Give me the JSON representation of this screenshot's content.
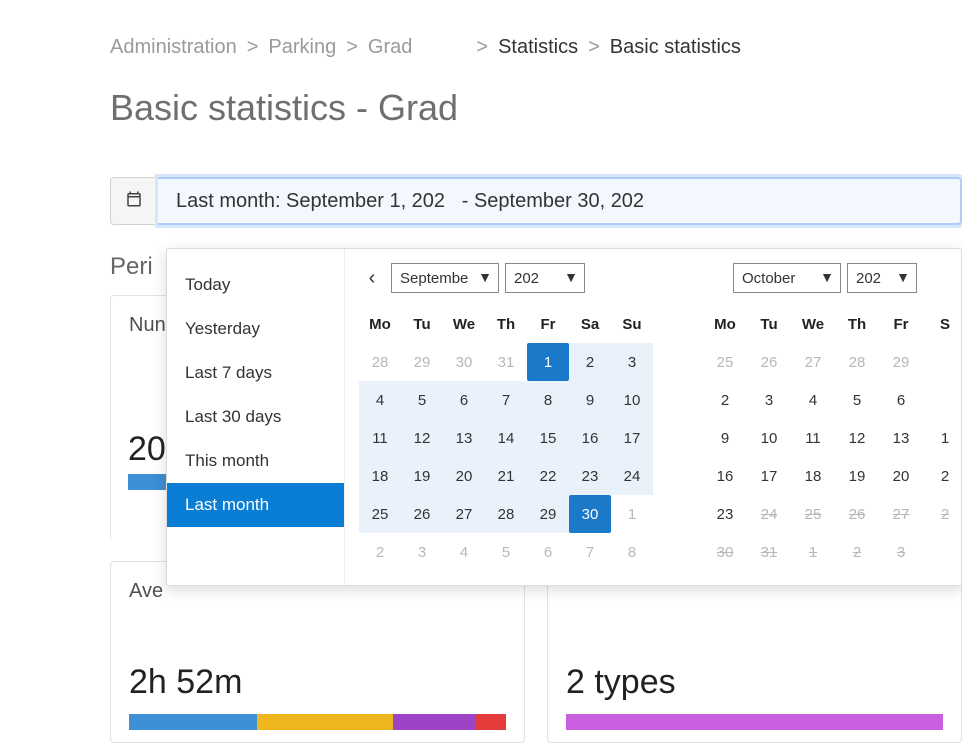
{
  "breadcrumb": {
    "items": [
      {
        "label": "Administration",
        "dark": false
      },
      {
        "label": "Parking",
        "dark": false
      },
      {
        "label": "Grad",
        "dark": false
      },
      {
        "label": "Statistics",
        "dark": true
      },
      {
        "label": "Basic statistics",
        "dark": true
      }
    ],
    "sep": ">"
  },
  "title": "Basic statistics - Grad",
  "date_range": {
    "value": "Last month: September 1, 202   - September 30, 202"
  },
  "section_label": "Peri",
  "cards": {
    "num": {
      "label": "Nun",
      "value": "20"
    },
    "avg": {
      "label": "Ave",
      "value": "2h 52m",
      "bar": [
        {
          "color": "#3e8fd4",
          "flex": 34
        },
        {
          "color": "#f0b61e",
          "flex": 36
        },
        {
          "color": "#9b44c6",
          "flex": 22
        },
        {
          "color": "#e43b3b",
          "flex": 8
        }
      ]
    },
    "types": {
      "value": "2 types",
      "bar": [
        {
          "color": "#c95fde",
          "flex": 100
        }
      ]
    }
  },
  "picker": {
    "presets": [
      "Today",
      "Yesterday",
      "Last 7 days",
      "Last 30 days",
      "This month",
      "Last month"
    ],
    "selected_preset": "Last month",
    "weekdays": [
      "Mo",
      "Tu",
      "We",
      "Th",
      "Fr",
      "Sa",
      "Su"
    ],
    "left": {
      "month": "Septembe",
      "year": "202",
      "cells": [
        {
          "d": "28",
          "cls": "muted"
        },
        {
          "d": "29",
          "cls": "muted"
        },
        {
          "d": "30",
          "cls": "muted"
        },
        {
          "d": "31",
          "cls": "muted"
        },
        {
          "d": "1",
          "cls": "start"
        },
        {
          "d": "2",
          "cls": "in-range"
        },
        {
          "d": "3",
          "cls": "in-range"
        },
        {
          "d": "4",
          "cls": "in-range"
        },
        {
          "d": "5",
          "cls": "in-range"
        },
        {
          "d": "6",
          "cls": "in-range"
        },
        {
          "d": "7",
          "cls": "in-range"
        },
        {
          "d": "8",
          "cls": "in-range"
        },
        {
          "d": "9",
          "cls": "in-range"
        },
        {
          "d": "10",
          "cls": "in-range"
        },
        {
          "d": "11",
          "cls": "in-range"
        },
        {
          "d": "12",
          "cls": "in-range"
        },
        {
          "d": "13",
          "cls": "in-range"
        },
        {
          "d": "14",
          "cls": "in-range"
        },
        {
          "d": "15",
          "cls": "in-range"
        },
        {
          "d": "16",
          "cls": "in-range"
        },
        {
          "d": "17",
          "cls": "in-range"
        },
        {
          "d": "18",
          "cls": "in-range"
        },
        {
          "d": "19",
          "cls": "in-range"
        },
        {
          "d": "20",
          "cls": "in-range"
        },
        {
          "d": "21",
          "cls": "in-range"
        },
        {
          "d": "22",
          "cls": "in-range"
        },
        {
          "d": "23",
          "cls": "in-range"
        },
        {
          "d": "24",
          "cls": "in-range"
        },
        {
          "d": "25",
          "cls": "in-range"
        },
        {
          "d": "26",
          "cls": "in-range"
        },
        {
          "d": "27",
          "cls": "in-range"
        },
        {
          "d": "28",
          "cls": "in-range"
        },
        {
          "d": "29",
          "cls": "in-range"
        },
        {
          "d": "30",
          "cls": "end"
        },
        {
          "d": "1",
          "cls": "muted"
        },
        {
          "d": "2",
          "cls": "muted"
        },
        {
          "d": "3",
          "cls": "muted"
        },
        {
          "d": "4",
          "cls": "muted"
        },
        {
          "d": "5",
          "cls": "muted"
        },
        {
          "d": "6",
          "cls": "muted"
        },
        {
          "d": "7",
          "cls": "muted"
        },
        {
          "d": "8",
          "cls": "muted"
        }
      ]
    },
    "right": {
      "month": "October",
      "year": "202",
      "weekdays": [
        "Mo",
        "Tu",
        "We",
        "Th",
        "Fr",
        "S"
      ],
      "cells": [
        {
          "d": "25",
          "cls": "muted"
        },
        {
          "d": "26",
          "cls": "muted"
        },
        {
          "d": "27",
          "cls": "muted"
        },
        {
          "d": "28",
          "cls": "muted"
        },
        {
          "d": "29",
          "cls": "muted"
        },
        {
          "d": "",
          "cls": ""
        },
        {
          "d": "2",
          "cls": ""
        },
        {
          "d": "3",
          "cls": ""
        },
        {
          "d": "4",
          "cls": ""
        },
        {
          "d": "5",
          "cls": ""
        },
        {
          "d": "6",
          "cls": ""
        },
        {
          "d": "",
          "cls": ""
        },
        {
          "d": "9",
          "cls": ""
        },
        {
          "d": "10",
          "cls": ""
        },
        {
          "d": "11",
          "cls": ""
        },
        {
          "d": "12",
          "cls": ""
        },
        {
          "d": "13",
          "cls": ""
        },
        {
          "d": "1",
          "cls": ""
        },
        {
          "d": "16",
          "cls": ""
        },
        {
          "d": "17",
          "cls": ""
        },
        {
          "d": "18",
          "cls": ""
        },
        {
          "d": "19",
          "cls": ""
        },
        {
          "d": "20",
          "cls": ""
        },
        {
          "d": "2",
          "cls": ""
        },
        {
          "d": "23",
          "cls": ""
        },
        {
          "d": "24",
          "cls": "disabled"
        },
        {
          "d": "25",
          "cls": "disabled"
        },
        {
          "d": "26",
          "cls": "disabled"
        },
        {
          "d": "27",
          "cls": "disabled"
        },
        {
          "d": "2",
          "cls": "disabled"
        },
        {
          "d": "30",
          "cls": "disabled"
        },
        {
          "d": "31",
          "cls": "disabled"
        },
        {
          "d": "1",
          "cls": "disabled"
        },
        {
          "d": "2",
          "cls": "disabled"
        },
        {
          "d": "3",
          "cls": "disabled"
        },
        {
          "d": "",
          "cls": ""
        }
      ]
    }
  }
}
